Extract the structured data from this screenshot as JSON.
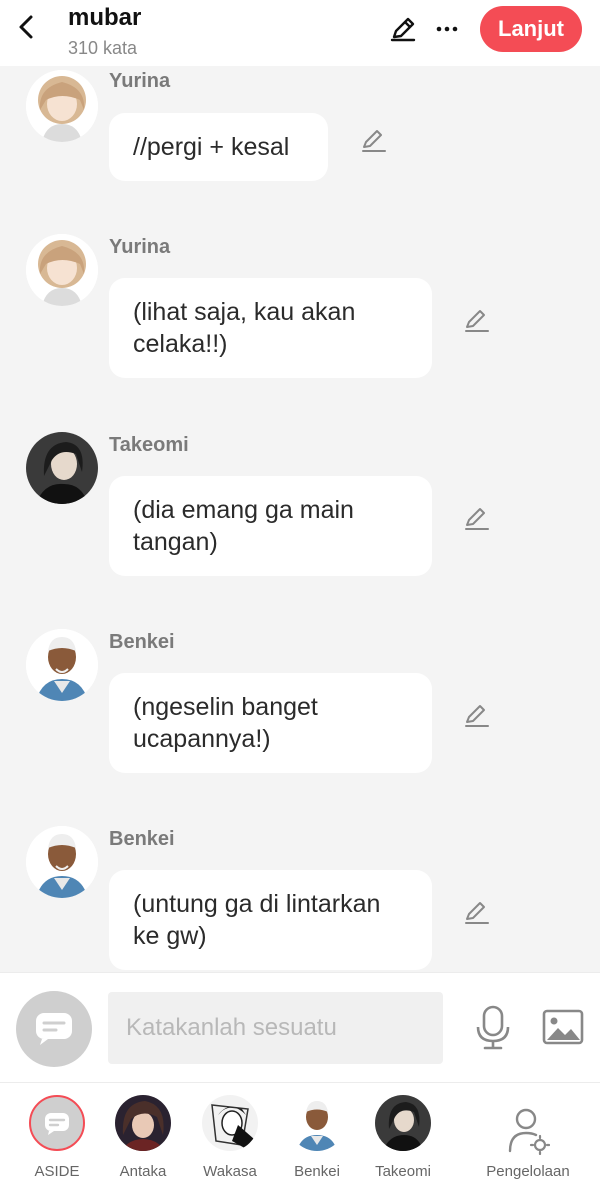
{
  "header": {
    "title": "mubar",
    "word_count": "310 kata",
    "next_label": "Lanjut",
    "icons": [
      "back-icon",
      "pen-icon",
      "more-icon"
    ]
  },
  "messages": [
    {
      "speaker": "Yurina",
      "text": "//pergi + kesal",
      "avatar": "yurina"
    },
    {
      "speaker": "Yurina",
      "text": "(lihat saja, kau akan celaka!!)",
      "avatar": "yurina"
    },
    {
      "speaker": "Takeomi",
      "text": "(dia emang ga main tangan)",
      "avatar": "takeomi"
    },
    {
      "speaker": "Benkei",
      "text": "(ngeselin banget ucapannya!)",
      "avatar": "benkei"
    },
    {
      "speaker": "Benkei",
      "text": "(untung ga di lintarkan ke gw)",
      "avatar": "benkei"
    }
  ],
  "composer": {
    "placeholder": "Katakanlah sesuatu",
    "icons": [
      "chat-bubble-icon",
      "microphone-icon",
      "image-icon"
    ]
  },
  "bottom_nav": [
    {
      "label": "ASIDE",
      "selected": true
    },
    {
      "label": "Antaka"
    },
    {
      "label": "Wakasa"
    },
    {
      "label": "Benkei"
    },
    {
      "label": "Takeomi"
    },
    {
      "label": "Pengelolaan"
    }
  ],
  "colors": {
    "accent": "#f44c55",
    "background": "#f4f4f4",
    "bubble": "#ffffff",
    "muted_text": "#888888"
  }
}
